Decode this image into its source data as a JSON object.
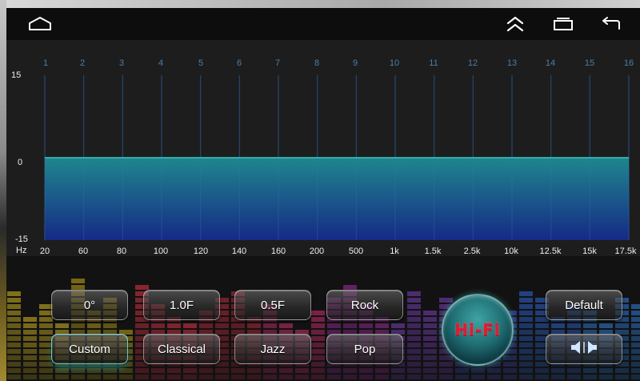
{
  "nav": {
    "home_icon": "home-icon",
    "up_icon": "double-chevron-up-icon",
    "recents_icon": "recent-apps-icon",
    "back_icon": "back-arrow-icon"
  },
  "eq": {
    "y_labels": {
      "top": "15",
      "mid": "0",
      "bottom": "-15"
    },
    "hz_label": "Hz",
    "bands": [
      {
        "num": "1",
        "freq": "20",
        "gain_db": 0
      },
      {
        "num": "2",
        "freq": "60",
        "gain_db": 0
      },
      {
        "num": "3",
        "freq": "80",
        "gain_db": 0
      },
      {
        "num": "4",
        "freq": "100",
        "gain_db": 0
      },
      {
        "num": "5",
        "freq": "120",
        "gain_db": 0
      },
      {
        "num": "6",
        "freq": "140",
        "gain_db": 0
      },
      {
        "num": "7",
        "freq": "160",
        "gain_db": 0
      },
      {
        "num": "8",
        "freq": "200",
        "gain_db": 0
      },
      {
        "num": "9",
        "freq": "500",
        "gain_db": 0
      },
      {
        "num": "10",
        "freq": "1k",
        "gain_db": 0
      },
      {
        "num": "11",
        "freq": "1.5k",
        "gain_db": 0
      },
      {
        "num": "12",
        "freq": "2.5k",
        "gain_db": 0
      },
      {
        "num": "13",
        "freq": "10k",
        "gain_db": 0
      },
      {
        "num": "14",
        "freq": "12.5k",
        "gain_db": 0
      },
      {
        "num": "15",
        "freq": "15k",
        "gain_db": 0
      },
      {
        "num": "16",
        "freq": "17.5k",
        "gain_db": 0
      }
    ],
    "range_db": [
      -15,
      15
    ],
    "colors": {
      "fill_top": "#1f8c93",
      "fill_bottom": "#152a8c",
      "line": "#3fc6c8"
    }
  },
  "presets": {
    "row1": [
      "0°",
      "1.0F",
      "0.5F",
      "Rock"
    ],
    "row2": [
      "Custom",
      "Classical",
      "Jazz",
      "Pop"
    ],
    "active": "Custom"
  },
  "hifi_label": "Hi-Fi",
  "default_label": "Default",
  "balance_icon": "speaker-balance-icon"
}
